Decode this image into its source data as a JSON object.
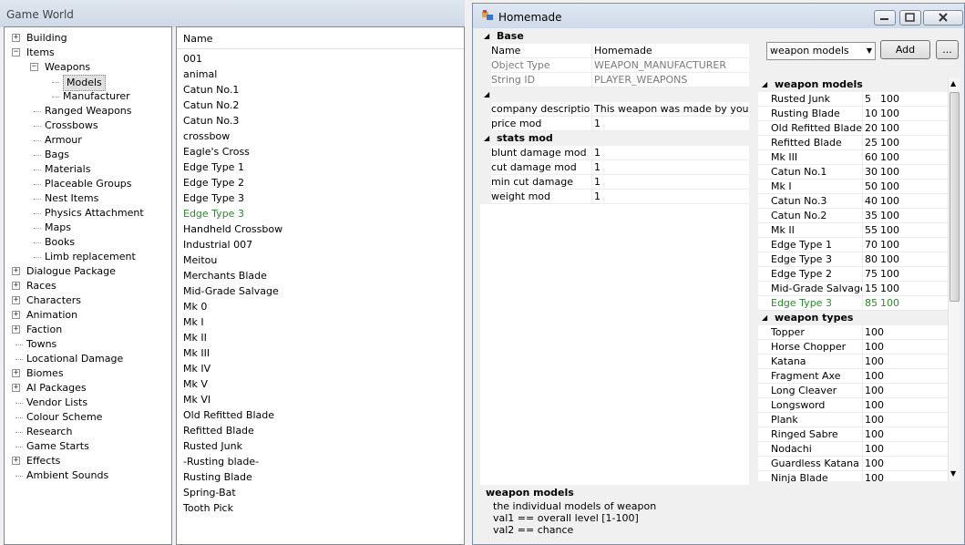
{
  "main_window": {
    "title": "Game World"
  },
  "tree": [
    {
      "label": "Building",
      "level": 0,
      "expander": "+"
    },
    {
      "label": "Items",
      "level": 0,
      "expander": "-"
    },
    {
      "label": "Weapons",
      "level": 1,
      "expander": "-"
    },
    {
      "label": "Models",
      "level": 2,
      "expander": "",
      "selected": true
    },
    {
      "label": "Manufacturer",
      "level": 2,
      "expander": ""
    },
    {
      "label": "Ranged Weapons",
      "level": 1,
      "expander": ""
    },
    {
      "label": "Crossbows",
      "level": 1,
      "expander": ""
    },
    {
      "label": "Armour",
      "level": 1,
      "expander": ""
    },
    {
      "label": "Bags",
      "level": 1,
      "expander": ""
    },
    {
      "label": "Materials",
      "level": 1,
      "expander": ""
    },
    {
      "label": "Placeable Groups",
      "level": 1,
      "expander": ""
    },
    {
      "label": "Nest Items",
      "level": 1,
      "expander": ""
    },
    {
      "label": "Physics Attachment",
      "level": 1,
      "expander": ""
    },
    {
      "label": "Maps",
      "level": 1,
      "expander": ""
    },
    {
      "label": "Books",
      "level": 1,
      "expander": ""
    },
    {
      "label": "Limb replacement",
      "level": 1,
      "expander": ""
    },
    {
      "label": "Dialogue Package",
      "level": 0,
      "expander": "+"
    },
    {
      "label": "Races",
      "level": 0,
      "expander": "+"
    },
    {
      "label": "Characters",
      "level": 0,
      "expander": "+"
    },
    {
      "label": "Animation",
      "level": 0,
      "expander": "+"
    },
    {
      "label": "Faction",
      "level": 0,
      "expander": "+"
    },
    {
      "label": "Towns",
      "level": 0,
      "expander": ""
    },
    {
      "label": "Locational Damage",
      "level": 0,
      "expander": ""
    },
    {
      "label": "Biomes",
      "level": 0,
      "expander": "+"
    },
    {
      "label": "AI Packages",
      "level": 0,
      "expander": "+"
    },
    {
      "label": "Vendor Lists",
      "level": 0,
      "expander": ""
    },
    {
      "label": "Colour Scheme",
      "level": 0,
      "expander": ""
    },
    {
      "label": "Research",
      "level": 0,
      "expander": ""
    },
    {
      "label": "Game Starts",
      "level": 0,
      "expander": ""
    },
    {
      "label": "Effects",
      "level": 0,
      "expander": "+"
    },
    {
      "label": "Ambient Sounds",
      "level": 0,
      "expander": ""
    }
  ],
  "list": {
    "header": "Name",
    "items": [
      {
        "label": "001"
      },
      {
        "label": "animal"
      },
      {
        "label": "Catun No.1"
      },
      {
        "label": "Catun No.2"
      },
      {
        "label": "Catun No.3"
      },
      {
        "label": "crossbow"
      },
      {
        "label": "Eagle's Cross"
      },
      {
        "label": "Edge Type 1"
      },
      {
        "label": "Edge Type 2"
      },
      {
        "label": "Edge Type 3"
      },
      {
        "label": "Edge Type 3",
        "highlight": true
      },
      {
        "label": "Handheld Crossbow"
      },
      {
        "label": "Industrial 007"
      },
      {
        "label": "Meitou"
      },
      {
        "label": "Merchants Blade"
      },
      {
        "label": "Mid-Grade Salvage"
      },
      {
        "label": "Mk 0"
      },
      {
        "label": "Mk I"
      },
      {
        "label": "Mk II"
      },
      {
        "label": "Mk III"
      },
      {
        "label": "Mk IV"
      },
      {
        "label": "Mk V"
      },
      {
        "label": "Mk VI"
      },
      {
        "label": "Old Refitted Blade"
      },
      {
        "label": "Refitted Blade"
      },
      {
        "label": "Rusted Junk"
      },
      {
        "label": "-Rusting blade-"
      },
      {
        "label": "Rusting Blade"
      },
      {
        "label": "Spring-Bat"
      },
      {
        "label": "Tooth Pick"
      }
    ]
  },
  "editor": {
    "title": "Homemade",
    "base_category": "Base",
    "base_rows": [
      {
        "name": "Name",
        "value": "Homemade",
        "readonly": false
      },
      {
        "name": "Object Type",
        "value": "WEAPON_MANUFACTURER",
        "readonly": true
      },
      {
        "name": "String ID",
        "value": "PLAYER_WEAPONS",
        "readonly": true
      }
    ],
    "misc_category": "",
    "misc_rows": [
      {
        "name": "company description",
        "value": "This weapon was made by your facti"
      },
      {
        "name": "price mod",
        "value": "1"
      }
    ],
    "stats_category": "stats mod",
    "stats_rows": [
      {
        "name": "blunt damage mod",
        "value": "1"
      },
      {
        "name": "cut damage mod",
        "value": "1"
      },
      {
        "name": "min cut damage",
        "value": "1"
      },
      {
        "name": "weight mod",
        "value": "1"
      }
    ],
    "dropdown_value": "weapon models",
    "add_label": "Add",
    "more_label": "...",
    "models_category": "weapon models",
    "models": [
      {
        "name": "Rusted Junk",
        "v1": "5",
        "v2": "100"
      },
      {
        "name": "Rusting Blade",
        "v1": "10",
        "v2": "100"
      },
      {
        "name": "Old Refitted Blade",
        "v1": "20",
        "v2": "100"
      },
      {
        "name": "Refitted Blade",
        "v1": "25",
        "v2": "100"
      },
      {
        "name": "Mk III",
        "v1": "60",
        "v2": "100"
      },
      {
        "name": "Catun No.1",
        "v1": "30",
        "v2": "100"
      },
      {
        "name": "Mk I",
        "v1": "50",
        "v2": "100"
      },
      {
        "name": "Catun No.3",
        "v1": "40",
        "v2": "100"
      },
      {
        "name": "Catun No.2",
        "v1": "35",
        "v2": "100"
      },
      {
        "name": "Mk II",
        "v1": "55",
        "v2": "100"
      },
      {
        "name": "Edge Type 1",
        "v1": "70",
        "v2": "100"
      },
      {
        "name": "Edge Type 3",
        "v1": "80",
        "v2": "100"
      },
      {
        "name": "Edge Type 2",
        "v1": "75",
        "v2": "100"
      },
      {
        "name": "Mid-Grade Salvage",
        "v1": "15",
        "v2": "100"
      },
      {
        "name": "Edge Type 3",
        "v1": "85",
        "v2": "100",
        "highlight": true
      }
    ],
    "types_category": "weapon types",
    "types": [
      {
        "name": "Topper",
        "v1": "100"
      },
      {
        "name": "Horse Chopper",
        "v1": "100"
      },
      {
        "name": "Katana",
        "v1": "100"
      },
      {
        "name": "Fragment Axe",
        "v1": "100"
      },
      {
        "name": "Long Cleaver",
        "v1": "100"
      },
      {
        "name": "Longsword",
        "v1": "100"
      },
      {
        "name": "Plank",
        "v1": "100"
      },
      {
        "name": "Ringed Sabre",
        "v1": "100"
      },
      {
        "name": "Nodachi",
        "v1": "100"
      },
      {
        "name": "Guardless Katana",
        "v1": "100"
      },
      {
        "name": "Ninja Blade",
        "v1": "100"
      }
    ],
    "description": {
      "heading": "weapon models",
      "lines": [
        "the individual models of weapon",
        "val1 == overall level [1-100]",
        "val2 == chance"
      ]
    }
  },
  "colors": {
    "highlight_green": "#2d8a2d"
  },
  "icons": [
    "plus-expander-icon",
    "minus-expander-icon",
    "collapse-arrow-icon",
    "dropdown-arrow-icon",
    "minimize-icon",
    "maximize-icon",
    "close-icon",
    "app-icon"
  ]
}
